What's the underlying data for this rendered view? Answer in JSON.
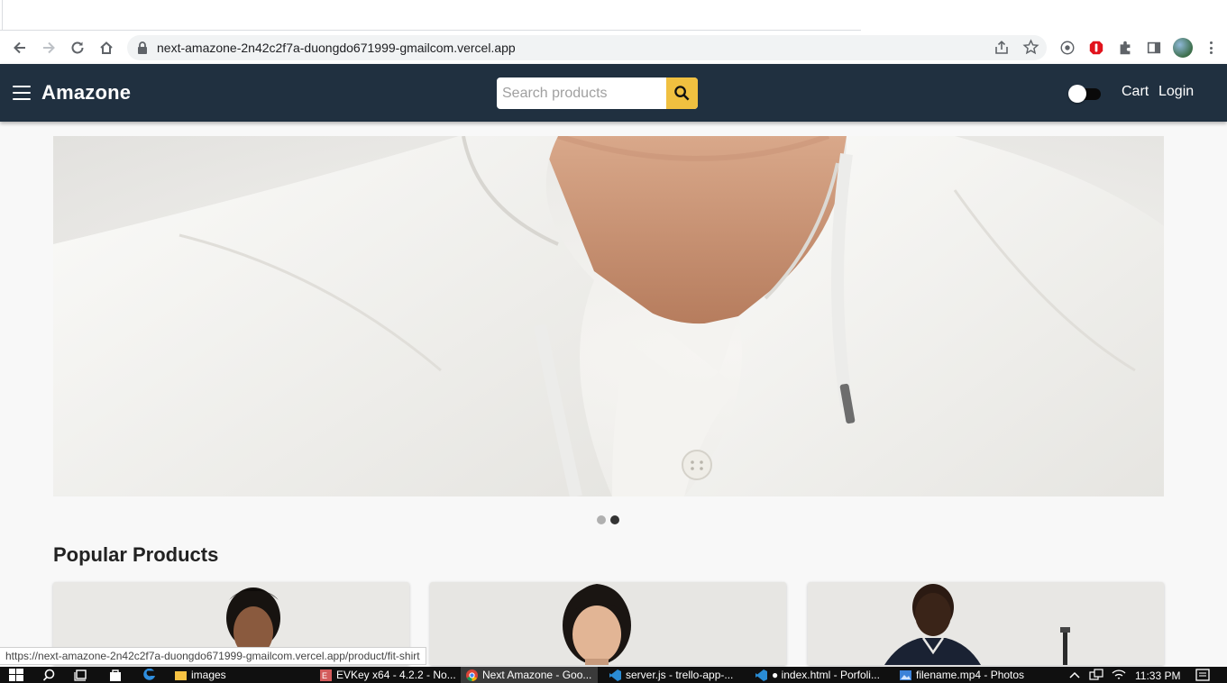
{
  "browser": {
    "url": "next-amazone-2n42c2f7a-duongdo671999-gmailcom.vercel.app",
    "status_url": "https://next-amazone-2n42c2f7a-duongdo671999-gmailcom.vercel.app/product/fit-shirt"
  },
  "header": {
    "brand": "Amazone",
    "search_placeholder": "Search products",
    "cart_label": "Cart",
    "login_label": "Login",
    "bg_color": "#203040",
    "accent_color": "#f0c040"
  },
  "hero": {
    "slides_count": 2,
    "active_slide": 2
  },
  "main": {
    "section_title": "Popular Products",
    "products": [
      {
        "slug": "free-shirt"
      },
      {
        "slug": "fit-shirt"
      },
      {
        "slug": "slim-shirt"
      }
    ]
  },
  "taskbar": {
    "tasks": [
      {
        "label": "images"
      },
      {
        "label": "EVKey x64 - 4.2.2 - No..."
      },
      {
        "label": "Next Amazone - Goo..."
      },
      {
        "label": "server.js - trello-app-..."
      },
      {
        "label": "● index.html - Porfoli..."
      },
      {
        "label": "filename.mp4 - Photos"
      }
    ],
    "time": "11:33 PM"
  }
}
